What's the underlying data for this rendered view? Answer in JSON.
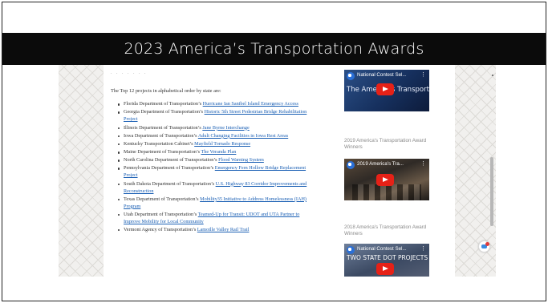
{
  "slide": {
    "title": "2023 America’s Transportation Awards"
  },
  "article": {
    "intro": "The Top 12 projects in alphabetical order by state are:",
    "items": [
      {
        "prefix": "Florida Department of Transportation’s ",
        "link": "Hurricane Ian Sanibel Island Emergency Access"
      },
      {
        "prefix": "Georgia Department of Transportation’s ",
        "link": "Historic 5th Street Pedestrian Bridge Rehabilitation Project"
      },
      {
        "prefix": "Illinois Department of Transportation’s ",
        "link": "Jane Byrne Interchange"
      },
      {
        "prefix": "Iowa Department of Transportation’s ",
        "link": "Adult Changing Facilities in Iowa Rest Areas"
      },
      {
        "prefix": "Kentucky Transportation Cabinet’s ",
        "link": "Mayfield Tornado Response"
      },
      {
        "prefix": "Maine Department of Transportation’s ",
        "link": "The Veranda Plan"
      },
      {
        "prefix": "North Carolina Department of Transportation’s ",
        "link": "Flood Warning System"
      },
      {
        "prefix": "Pennsylvania Department of Transportation’s ",
        "link": "Emergency Fern Hollow Bridge Replacement Project"
      },
      {
        "prefix": "South Dakota Department of Transportation’s ",
        "link": "U.S. Highway 83 Corridor Improvements and Reconstruction"
      },
      {
        "prefix": "Texas Department of Transportation’s ",
        "link": "Mobility35 Initiative to Address Homelessness (IAH) Program"
      },
      {
        "prefix": "Utah Department of Transportation’s ",
        "link": "Teamed-Up for Transit: UDOT and UTA Partner to Improve Mobility for Local Community"
      },
      {
        "prefix": "Vermont Agency of Transportation’s ",
        "link": "Lamoille Valley Rail Trail"
      }
    ]
  },
  "sidebar": {
    "videos": [
      {
        "title": "National Contest Sel...",
        "overlay": "The America's Transportation",
        "caption": ""
      },
      {
        "title": "2019 America's Tra...",
        "overlay": "",
        "caption": "2019 America's Transportation Award Winners"
      },
      {
        "title": "National Contest Sel...",
        "overlay": "TWO STATE DOT PROJECTS WIN",
        "caption": "2018 America's Transportation Award Winners"
      }
    ]
  },
  "colors": {
    "title_bar": "#0b0b0b",
    "link": "#1a5fb4",
    "play_button": "#e62117"
  }
}
